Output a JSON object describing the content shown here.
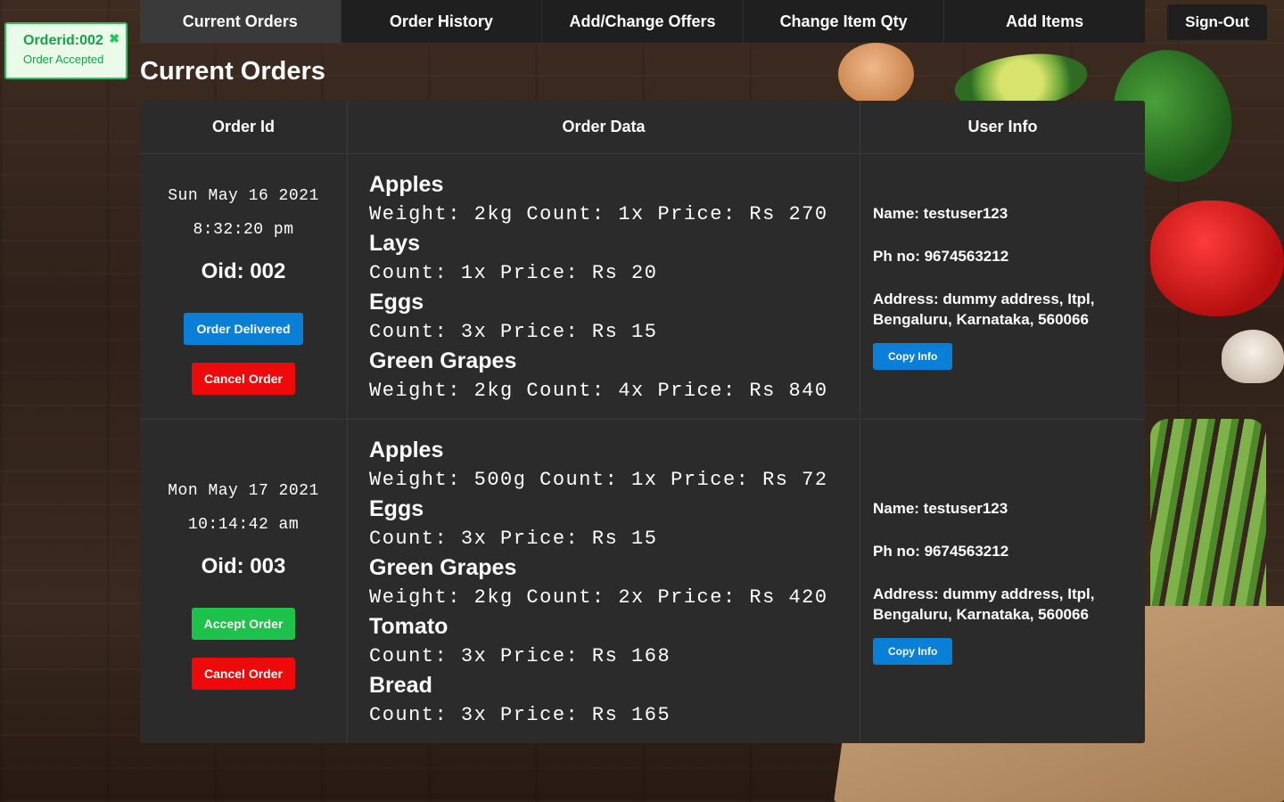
{
  "toast": {
    "title": "Orderid:002",
    "message": "Order Accepted",
    "close_icon": "✖"
  },
  "nav": {
    "tabs": [
      "Current Orders",
      "Order History",
      "Add/Change Offers",
      "Change Item Qty",
      "Add Items"
    ],
    "active": "Current Orders",
    "signout": "Sign-Out"
  },
  "page_title": "Current Orders",
  "table": {
    "headers": [
      "Order Id",
      "Order Data",
      "User Info"
    ],
    "orders": [
      {
        "date": "Sun May 16 2021",
        "time": "8:32:20 pm",
        "oid": "Oid: 002",
        "primary_action": "Order Delivered",
        "cancel": "Cancel Order",
        "items": [
          {
            "name": "Apples",
            "detail": "Weight: 2kg Count: 1x Price: Rs 270"
          },
          {
            "name": "Lays",
            "detail": "Count: 1x Price: Rs 20"
          },
          {
            "name": "Eggs",
            "detail": "Count: 3x Price: Rs 15"
          },
          {
            "name": "Green Grapes",
            "detail": "Weight: 2kg Count: 4x Price: Rs 840"
          }
        ],
        "user": {
          "name": "Name: testuser123",
          "phone": "Ph no: 9674563212",
          "address": "Address: dummy address, Itpl, Bengaluru, Karnataka, 560066",
          "copy": "Copy Info"
        }
      },
      {
        "date": "Mon May 17 2021",
        "time": "10:14:42 am",
        "oid": "Oid: 003",
        "primary_action": "Accept Order",
        "cancel": "Cancel Order",
        "items": [
          {
            "name": "Apples",
            "detail": "Weight: 500g Count: 1x Price: Rs 72"
          },
          {
            "name": "Eggs",
            "detail": "Count: 3x Price: Rs 15"
          },
          {
            "name": "Green Grapes",
            "detail": "Weight: 2kg Count: 2x Price: Rs 420"
          },
          {
            "name": "Tomato",
            "detail": "Count: 3x Price: Rs 168"
          },
          {
            "name": "Bread",
            "detail": "Count: 3x Price: Rs 165"
          }
        ],
        "user": {
          "name": "Name: testuser123",
          "phone": "Ph no: 9674563212",
          "address": "Address: dummy address, Itpl, Bengaluru, Karnataka, 560066",
          "copy": "Copy Info"
        }
      }
    ]
  },
  "colors": {
    "accent_blue": "#0a7fd8",
    "danger_red": "#ee0a0a",
    "success_green": "#1cc24a",
    "toast_green": "#16a34a"
  }
}
